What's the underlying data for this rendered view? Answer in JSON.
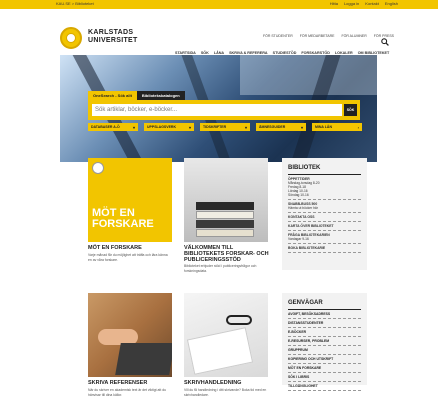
{
  "topbar": {
    "breadcrumb": "KAU.SE > Biblioteket",
    "links": [
      "Hitta",
      "Logga in",
      "Kontakt",
      "English"
    ]
  },
  "logo": {
    "line1": "KARLSTADS",
    "line2": "UNIVERSITET"
  },
  "quicklinks": [
    "FÖR STUDENTER",
    "FÖR MEDARBETARE",
    "FÖR ALUMNER",
    "FÖR PRESS"
  ],
  "mainnav": [
    "STARTSIDA",
    "SÖK",
    "LÅNA",
    "SKRIVA & REFERERA",
    "STUDIESTÖD",
    "FORSKARSTÖD",
    "LOKALER",
    "OM BIBLIOTEKET"
  ],
  "search": {
    "tabs": [
      "OneSearch - Sök allt",
      "Bibliotekskatalogen"
    ],
    "placeholder": "Sök artiklar, böcker, e-böcker...",
    "button": "SÖK",
    "filters": [
      "DATABASER A-Ö",
      "UPPSLAGSVERK",
      "TIDSKRIFTER",
      "ÄMNESGUIDER",
      "MINA LÅN"
    ]
  },
  "cards": [
    {
      "image_text": "MÖT EN FORSKARE",
      "title": "MÖT EN FORSKARE",
      "text": "Varje månad får du möjlighet att träffa och lära känna en av våra forskare."
    },
    {
      "title": "VÄLKOMMEN TILL BIBLIOTEKETS FORSKAR- OCH PUBLICERINGSSTÖD",
      "text": "Biblioteket erbjuder stöd i publiceringsfrågor och forskningsdata."
    },
    {
      "title": "SKRIVA REFERENSER",
      "text": "När du skriver en akademisk text är det viktigt att du hänvisar till dina källor."
    },
    {
      "title": "SKRIVHANDLEDNING",
      "text": "Vill du få handledning i ditt skrivande? Boka tid med en skrivhandledare."
    }
  ],
  "library": {
    "title": "BIBLIOTEK",
    "rows": [
      {
        "label": "ÖPPETTIDER",
        "lines": [
          "Måndag-torsdag 8-20",
          "Fredag 8-18",
          "Lördag 10-16",
          "Söndag 10-16"
        ]
      },
      {
        "label": "SNABB-BUSS 500",
        "lines": [
          "Hämta ut böcker här"
        ]
      },
      {
        "label": "KONTAKTA OSS",
        "lines": []
      },
      {
        "label": "KARTA ÖVER BIBLIOTEKET",
        "lines": []
      },
      {
        "label": "FRÅGA BIBLIOTEKARIEN",
        "lines": [
          "Vardagar 9-16"
        ]
      },
      {
        "label": "BOKA BIBLIOTEKARIE",
        "lines": []
      }
    ]
  },
  "shortcuts": {
    "title": "GENVÄGAR",
    "items": [
      "AVGIFT, BESÖKSADRESS",
      "DISTANSSTUDENTER",
      "E-BÖCKER",
      "E-RESURSER, PROBLEM",
      "GRUPPRUM",
      "KOPIERING OCH UTSKRIFT",
      "MÖT EN FORSKARE",
      "SÖK I LIBRIS",
      "TILLGÄNGLIGHET"
    ]
  },
  "colors": {
    "brand_yellow": "#f2c500",
    "dark": "#222222"
  }
}
